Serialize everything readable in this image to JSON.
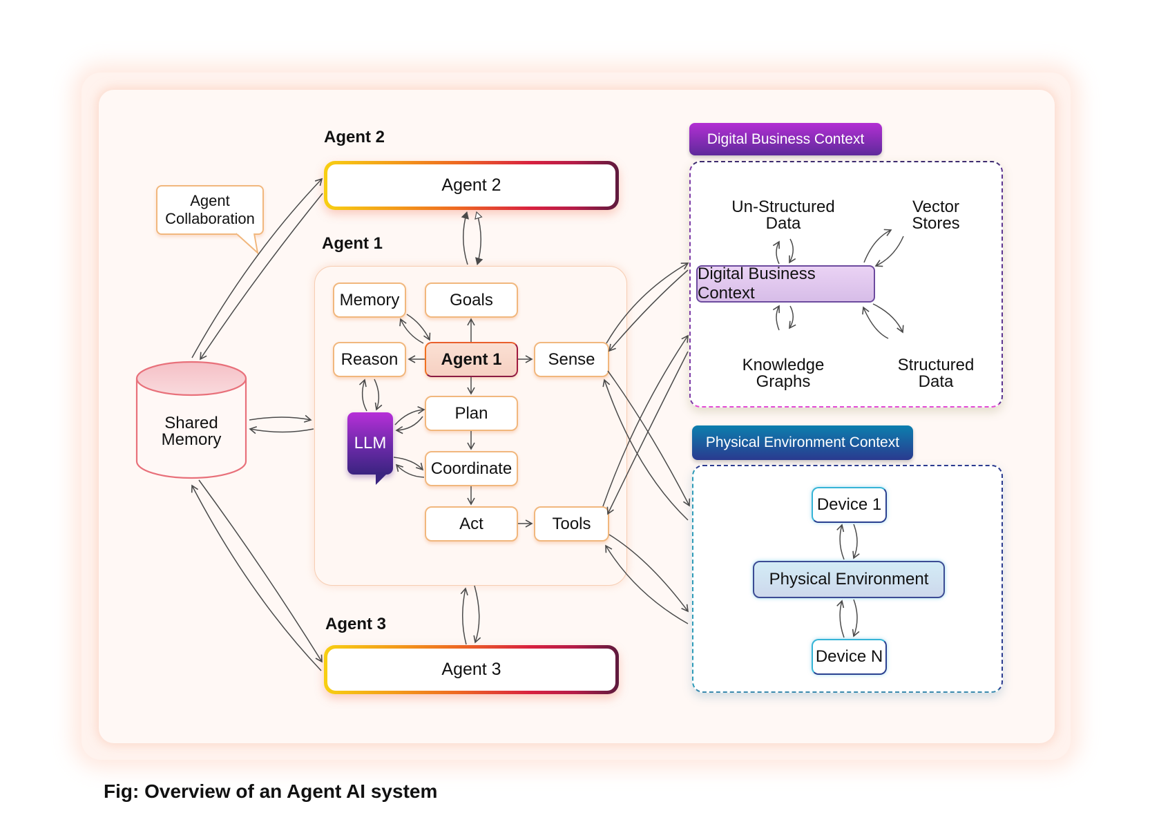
{
  "caption": "Fig: Overview of an Agent AI system",
  "labels": {
    "agent2": "Agent 2",
    "agent1": "Agent 1",
    "agent3": "Agent 3"
  },
  "agents": {
    "agent2_box": "Agent 2",
    "agent3_box": "Agent 3"
  },
  "callout": {
    "line1": "Agent",
    "line2": "Collaboration"
  },
  "shared_memory": {
    "line1": "Shared",
    "line2": "Memory"
  },
  "agent1_nodes": {
    "memory": "Memory",
    "goals": "Goals",
    "reason": "Reason",
    "agent1": "Agent 1",
    "sense": "Sense",
    "plan": "Plan",
    "coordinate": "Coordinate",
    "act": "Act",
    "tools": "Tools",
    "llm": "LLM"
  },
  "digital_context": {
    "header": "Digital Business Context",
    "center": "Digital Business Context",
    "stores": [
      {
        "line1": "Un-Structured",
        "line2": "Data"
      },
      {
        "line1": "Vector",
        "line2": "Stores"
      },
      {
        "line1": "Knowledge",
        "line2": "Graphs"
      },
      {
        "line1": "Structured",
        "line2": "Data"
      }
    ]
  },
  "physical_context": {
    "header": "Physical Environment Context",
    "center": "Physical Environment",
    "device_top": "Device 1",
    "device_bottom": "Device N"
  },
  "colors": {
    "agent_gradient": [
      "#f7cf12",
      "#ee6a22",
      "#d8213f",
      "#5e1a3d"
    ],
    "node_border": "#f1b77d",
    "cylinder_stroke": "#e8707a",
    "cylinder_top": "#f6c8cc",
    "llm_gradient": [
      "#b72fd8",
      "#3a2380"
    ],
    "dbc_header": [
      "#b32fd3",
      "#5e2a9b"
    ],
    "pec_header": [
      "#0c7fae",
      "#2a3a8f"
    ],
    "arrow": "#4a4a4a"
  }
}
